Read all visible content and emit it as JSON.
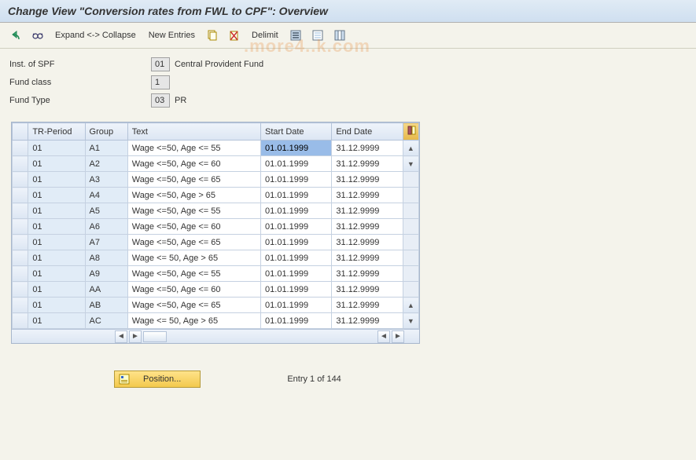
{
  "title": "Change View \"Conversion rates from FWL to CPF\": Overview",
  "toolbar": {
    "expand": "Expand <-> Collapse",
    "new_entries": "New Entries",
    "delimit": "Delimit"
  },
  "form": {
    "inst_label": "Inst. of SPF",
    "inst_code": "01",
    "inst_desc": "Central Provident Fund",
    "class_label": "Fund class",
    "class_code": "1",
    "type_label": "Fund Type",
    "type_code": "03",
    "type_desc": "PR"
  },
  "table": {
    "headers": {
      "tr": "TR-Period",
      "group": "Group",
      "text": "Text",
      "start": "Start Date",
      "end": "End Date"
    },
    "rows": [
      {
        "tr": "01",
        "group": "A1",
        "text": "Wage <=50, Age <= 55",
        "start": "01.01.1999",
        "end": "31.12.9999",
        "selected": true
      },
      {
        "tr": "01",
        "group": "A2",
        "text": "Wage <=50, Age <= 60",
        "start": "01.01.1999",
        "end": "31.12.9999"
      },
      {
        "tr": "01",
        "group": "A3",
        "text": "Wage <=50, Age <= 65",
        "start": "01.01.1999",
        "end": "31.12.9999"
      },
      {
        "tr": "01",
        "group": "A4",
        "text": "Wage <=50, Age >  65",
        "start": "01.01.1999",
        "end": "31.12.9999"
      },
      {
        "tr": "01",
        "group": "A5",
        "text": "Wage <=50, Age <= 55",
        "start": "01.01.1999",
        "end": "31.12.9999"
      },
      {
        "tr": "01",
        "group": "A6",
        "text": "Wage <=50, Age <= 60",
        "start": "01.01.1999",
        "end": "31.12.9999"
      },
      {
        "tr": "01",
        "group": "A7",
        "text": "Wage <=50, Age <= 65",
        "start": "01.01.1999",
        "end": "31.12.9999"
      },
      {
        "tr": "01",
        "group": "A8",
        "text": "Wage <= 50, Age > 65",
        "start": "01.01.1999",
        "end": "31.12.9999"
      },
      {
        "tr": "01",
        "group": "A9",
        "text": "Wage <=50, Age <= 55",
        "start": "01.01.1999",
        "end": "31.12.9999"
      },
      {
        "tr": "01",
        "group": "AA",
        "text": "Wage <=50, Age <= 60",
        "start": "01.01.1999",
        "end": "31.12.9999"
      },
      {
        "tr": "01",
        "group": "AB",
        "text": "Wage <=50, Age <= 65",
        "start": "01.01.1999",
        "end": "31.12.9999"
      },
      {
        "tr": "01",
        "group": "AC",
        "text": "Wage <= 50, Age > 65",
        "start": "01.01.1999",
        "end": "31.12.9999"
      }
    ]
  },
  "footer": {
    "position_label": "Position...",
    "entry_text": "Entry 1 of 144"
  },
  "watermark": ".more4..k.com"
}
